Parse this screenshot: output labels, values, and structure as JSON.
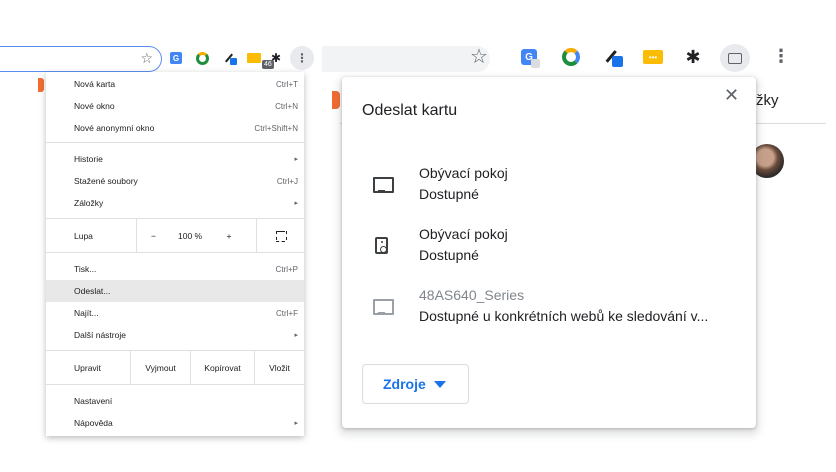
{
  "left_menu": {
    "items": [
      {
        "label": "Nová karta",
        "shortcut": "Ctrl+T"
      },
      {
        "label": "Nové okno",
        "shortcut": "Ctrl+N"
      },
      {
        "label": "Nové anonymní okno",
        "shortcut": "Ctrl+Shift+N"
      },
      {
        "label": "Historie",
        "arrow": "▸"
      },
      {
        "label": "Stažené soubory",
        "shortcut": "Ctrl+J"
      },
      {
        "label": "Záložky",
        "arrow": "▸"
      },
      {
        "label": "Tisk...",
        "shortcut": "Ctrl+P"
      },
      {
        "label": "Odeslat...",
        "shortcut": ""
      },
      {
        "label": "Najít...",
        "shortcut": "Ctrl+F"
      },
      {
        "label": "Další nástroje",
        "arrow": "▸"
      },
      {
        "label": "Nastavení",
        "shortcut": ""
      },
      {
        "label": "Nápověda",
        "arrow": "▸"
      }
    ],
    "zoom": {
      "label": "Lupa",
      "minus": "−",
      "value": "100 %",
      "plus": "+"
    },
    "edit": {
      "label": "Upravit",
      "cut": "Vyjmout",
      "copy": "Kopírovat",
      "paste": "Vložit"
    },
    "highlighted": "Odeslat...",
    "badge": "46"
  },
  "cast_dialog": {
    "title": "Odeslat kartu",
    "close": "✕",
    "sinks": [
      {
        "name": "Obývací pokoj",
        "status": "Dostupné",
        "icon": "tv-icon"
      },
      {
        "name": "Obývací pokoj",
        "status": "Dostupné",
        "icon": "speaker-icon"
      },
      {
        "name": "48AS640_Series",
        "status": "Dostupné u konkrétních webů ke sledování v...",
        "icon": "tv-icon"
      }
    ],
    "sources_label": "Zdroje"
  },
  "right_page": {
    "bookmarks_fragment": "žky"
  },
  "colors": {
    "accent": "#1a73e8",
    "highlight": "#e8e8e8"
  }
}
